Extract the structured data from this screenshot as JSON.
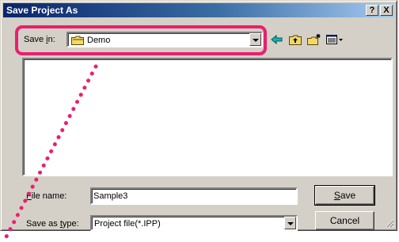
{
  "window": {
    "title": "Save Project As"
  },
  "titlebar_buttons": {
    "help": "?",
    "close": "X"
  },
  "save_in": {
    "label_prefix": "Save ",
    "label_accel": "i",
    "label_suffix": "n:",
    "value": "Demo",
    "value_icon": "folder-icon"
  },
  "toolbar": {
    "items": [
      {
        "name": "back-icon"
      },
      {
        "name": "up-one-level-icon"
      },
      {
        "name": "create-new-folder-icon"
      },
      {
        "name": "view-menu-icon"
      }
    ]
  },
  "file_name": {
    "label_accel": "F",
    "label_rest": "ile name:",
    "value": "Sample3"
  },
  "save_as_type": {
    "label_prefix": "Save as ",
    "label_accel": "t",
    "label_suffix": "ype:",
    "value": "Project file(*.IPP)"
  },
  "buttons": {
    "save_accel": "S",
    "save_rest": "ave",
    "cancel": "Cancel"
  },
  "colors": {
    "highlight": "#ea1f6e",
    "title_bar_start": "#0a246a",
    "title_bar_end": "#a6caf0",
    "dialog_face": "#d4d0c8"
  }
}
